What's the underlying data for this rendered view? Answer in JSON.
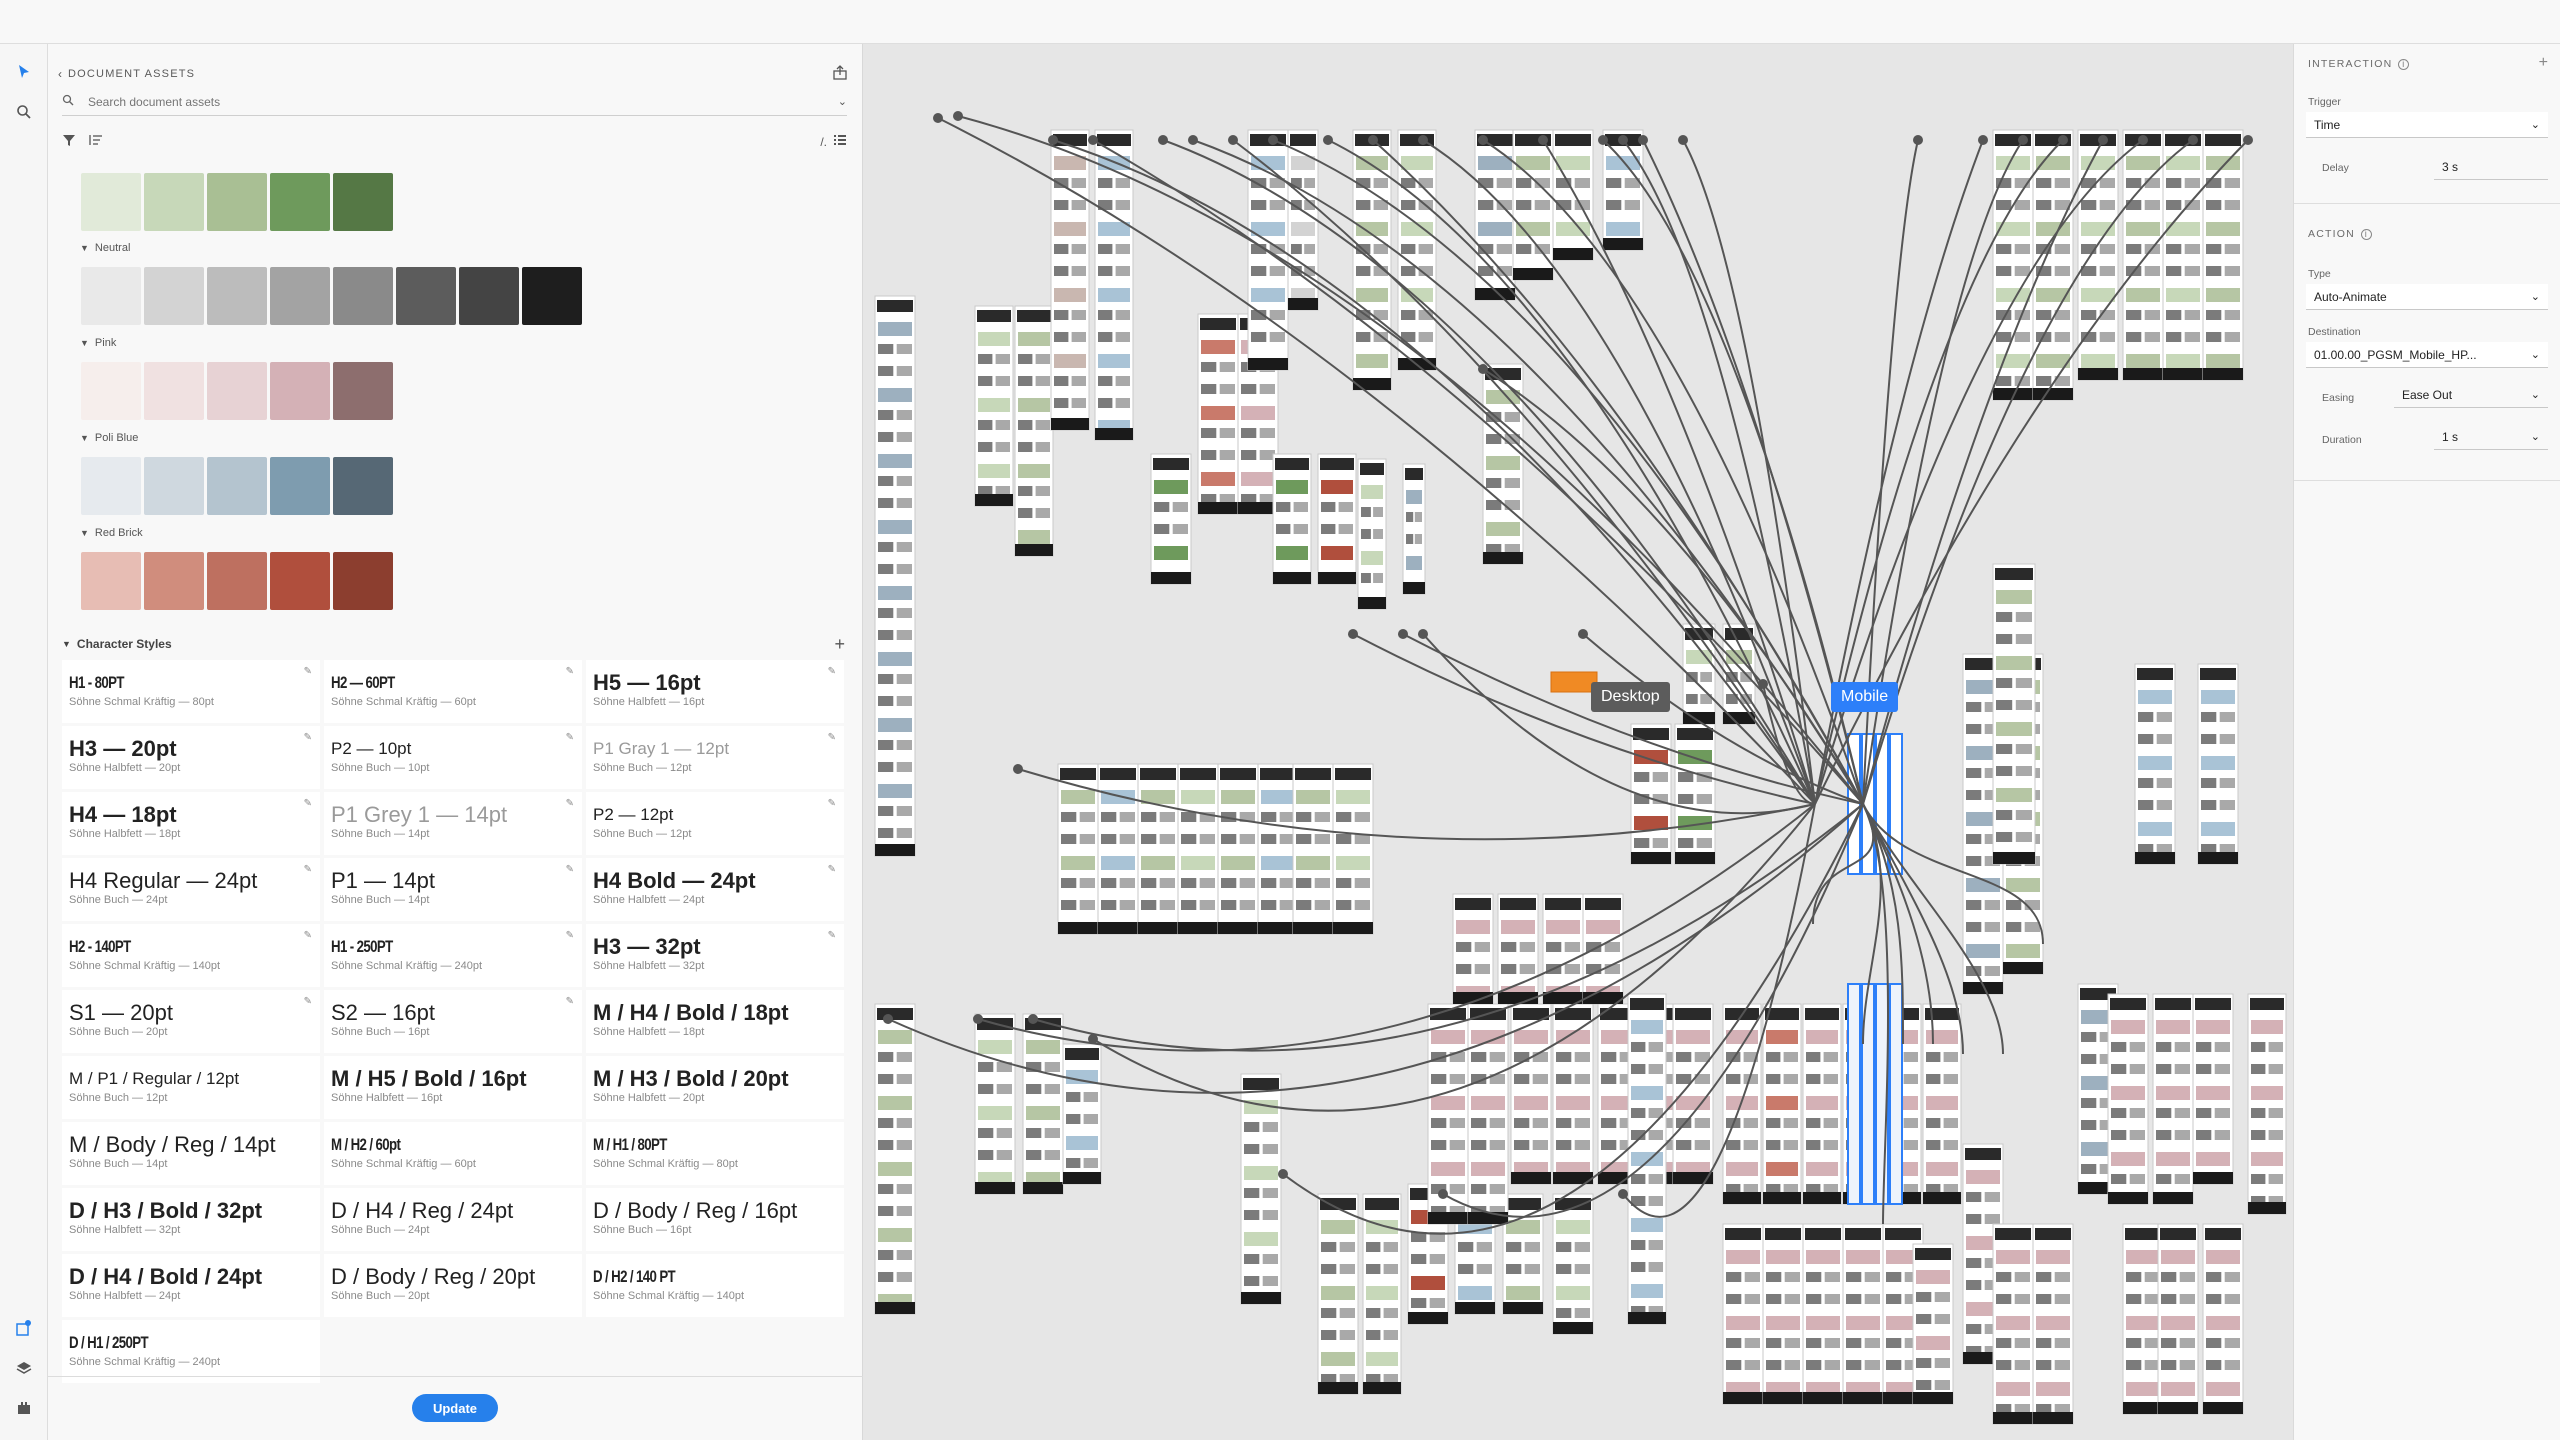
{
  "assets_panel": {
    "title": "DOCUMENT ASSETS",
    "search_placeholder": "Search document assets",
    "color_groups": [
      {
        "name": "",
        "colors": [
          "#e1ead9",
          "#c7d8b9",
          "#a9bf94",
          "#6e9a5c",
          "#557845"
        ]
      },
      {
        "name": "Neutral",
        "colors": [
          "#e9e9e9",
          "#d3d3d3",
          "#bcbcbc",
          "#a3a3a3",
          "#8a8a8a",
          "#5c5c5c",
          "#444444",
          "#1e1e1e"
        ]
      },
      {
        "name": "Pink",
        "colors": [
          "#f6eeec",
          "#f0e1e1",
          "#e7d2d4",
          "#d4b1b6",
          "#8d6e6e"
        ]
      },
      {
        "name": "Poli Blue",
        "colors": [
          "#e6eaee",
          "#cfd8df",
          "#b4c4cf",
          "#7e9caf",
          "#566875"
        ]
      },
      {
        "name": "Red Brick",
        "colors": [
          "#e7bdb4",
          "#d08d7d",
          "#be7060",
          "#b04f3d",
          "#8c3e2f"
        ]
      }
    ],
    "character_styles_label": "Character Styles",
    "character_styles": [
      {
        "title": "H1 - 80PT",
        "sub": "Söhne Schmal Kräftig — 80pt",
        "style": "cond"
      },
      {
        "title": "H2 — 60PT",
        "sub": "Söhne Schmal Kräftig — 60pt",
        "style": "cond"
      },
      {
        "title": "H5 — 16pt",
        "sub": "Söhne Halbfett — 16pt",
        "style": "bold"
      },
      {
        "title": "H3 — 20pt",
        "sub": "Söhne Halbfett — 20pt",
        "style": "bold"
      },
      {
        "title": "P2 — 10pt",
        "sub": "Söhne Buch — 10pt",
        "style": "sm"
      },
      {
        "title": "P1 Gray 1 — 12pt",
        "sub": "Söhne Buch — 12pt",
        "style": "grey-sm"
      },
      {
        "title": "H4 — 18pt",
        "sub": "Söhne Halbfett — 18pt",
        "style": "bold"
      },
      {
        "title": "P1 Grey 1 — 14pt",
        "sub": "Söhne Buch — 14pt",
        "style": "grey"
      },
      {
        "title": "P2 — 12pt",
        "sub": "Söhne Buch — 12pt",
        "style": "sm"
      },
      {
        "title": "H4 Regular — 24pt",
        "sub": "Söhne Buch — 24pt",
        "style": "reg"
      },
      {
        "title": "P1 — 14pt",
        "sub": "Söhne Buch — 14pt",
        "style": "reg"
      },
      {
        "title": "H4 Bold — 24pt",
        "sub": "Söhne Halbfett — 24pt",
        "style": "bold"
      },
      {
        "title": "H2 - 140PT",
        "sub": "Söhne Schmal Kräftig — 140pt",
        "style": "cond"
      },
      {
        "title": "H1 - 250PT",
        "sub": "Söhne Schmal Kräftig — 240pt",
        "style": "cond"
      },
      {
        "title": "H3 — 32pt",
        "sub": "Söhne Halbfett — 32pt",
        "style": "bold"
      },
      {
        "title": "S1 — 20pt",
        "sub": "Söhne Buch — 20pt",
        "style": "reg"
      },
      {
        "title": "S2 — 16pt",
        "sub": "Söhne Buch — 16pt",
        "style": "reg"
      },
      {
        "title": "M / H4 / Bold / 18pt",
        "sub": "Söhne Halbfett — 18pt",
        "style": "bold"
      },
      {
        "title": "M / P1 / Regular / 12pt",
        "sub": "Söhne Buch — 12pt",
        "style": "sm"
      },
      {
        "title": "M / H5 / Bold / 16pt",
        "sub": "Söhne Halbfett — 16pt",
        "style": "bold"
      },
      {
        "title": "M / H3 / Bold / 20pt",
        "sub": "Söhne Halbfett — 20pt",
        "style": "bold"
      },
      {
        "title": "M / Body / Reg / 14pt",
        "sub": "Söhne Buch — 14pt",
        "style": "reg"
      },
      {
        "title": "M / H2 / 60pt",
        "sub": "Söhne Schmal Kräftig — 60pt",
        "style": "cond"
      },
      {
        "title": "M / H1 / 80PT",
        "sub": "Söhne Schmal Kräftig — 80pt",
        "style": "cond"
      },
      {
        "title": "D / H3 / Bold / 32pt",
        "sub": "Söhne Halbfett — 32pt",
        "style": "bold"
      },
      {
        "title": "D / H4 / Reg / 24pt",
        "sub": "Söhne Buch — 24pt",
        "style": "reg"
      },
      {
        "title": "D / Body / Reg / 16pt",
        "sub": "Söhne Buch — 16pt",
        "style": "reg"
      },
      {
        "title": "D / H4 / Bold / 24pt",
        "sub": "Söhne Halbfett — 24pt",
        "style": "bold"
      },
      {
        "title": "D / Body / Reg / 20pt",
        "sub": "Söhne Buch — 20pt",
        "style": "reg"
      },
      {
        "title": "D / H2 / 140 PT",
        "sub": "Söhne Schmal Kräftig — 140pt",
        "style": "cond"
      },
      {
        "title": "D / H1 / 250PT",
        "sub": "Söhne Schmal Kräftig — 240pt",
        "style": "cond"
      }
    ],
    "update_label": "Update"
  },
  "canvas": {
    "desktop_tag": "Desktop",
    "mobile_tag": "Mobile",
    "colors": {
      "wire": "#555555",
      "mobile_accent": "#2d7ff9",
      "desktop_tag_bg": "#5c5c5c"
    }
  },
  "inspector": {
    "interaction_title": "INTERACTION",
    "trigger_label": "Trigger",
    "trigger_value": "Time",
    "delay_label": "Delay",
    "delay_value": "3 s",
    "action_title": "ACTION",
    "type_label": "Type",
    "type_value": "Auto-Animate",
    "destination_label": "Destination",
    "destination_value": "01.00.00_PGSM_Mobile_HP...",
    "easing_label": "Easing",
    "easing_value": "Ease Out",
    "duration_label": "Duration",
    "duration_value": "1 s"
  },
  "icons": {
    "select_tool": "arrow-select-icon",
    "zoom_tool": "search-icon",
    "plugins": "plugins-icon",
    "layers": "layers-icon",
    "assets": "assets-icon"
  }
}
